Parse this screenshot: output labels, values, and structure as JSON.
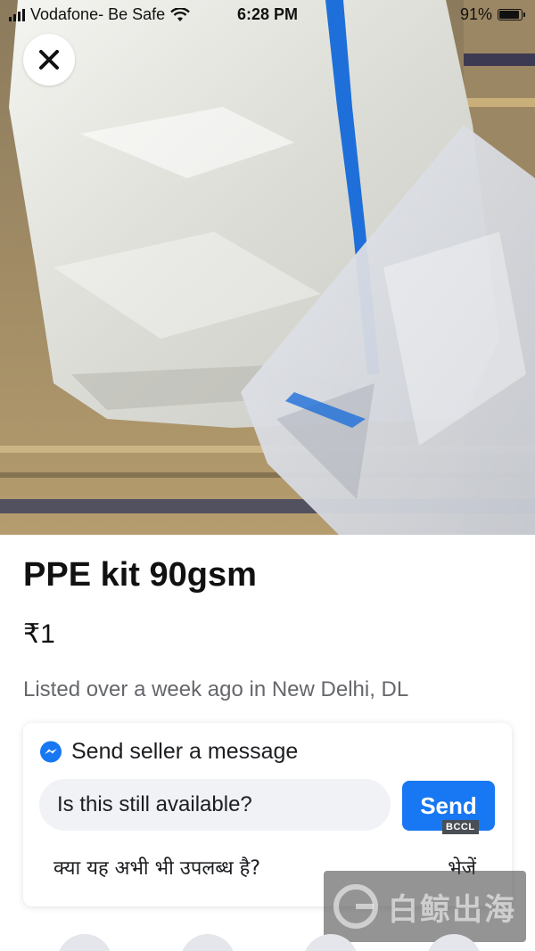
{
  "status_bar": {
    "carrier": "Vodafone- Be Safe",
    "time": "6:28 PM",
    "battery": "91%",
    "battery_level": 0.91
  },
  "icons": {
    "close": "close-icon",
    "messenger": "messenger-icon",
    "wifi": "wifi-icon",
    "signal": "signal-icon",
    "battery": "battery-icon"
  },
  "listing": {
    "title": "PPE kit 90gsm",
    "price": "₹1",
    "meta": "Listed over a week ago in New Delhi, DL"
  },
  "message": {
    "header": "Send seller a message",
    "input_value": "Is this still available?",
    "send_label": "Send",
    "badge": "BCCL",
    "translation_question": "क्या यह अभी भी उपलब्ध है?",
    "translation_send": "भेजें"
  },
  "watermark": {
    "text": "白鲸出海"
  },
  "colors": {
    "accent": "#1877f2",
    "secondary_text": "#65676b",
    "input_bg": "#f0f2f5"
  }
}
